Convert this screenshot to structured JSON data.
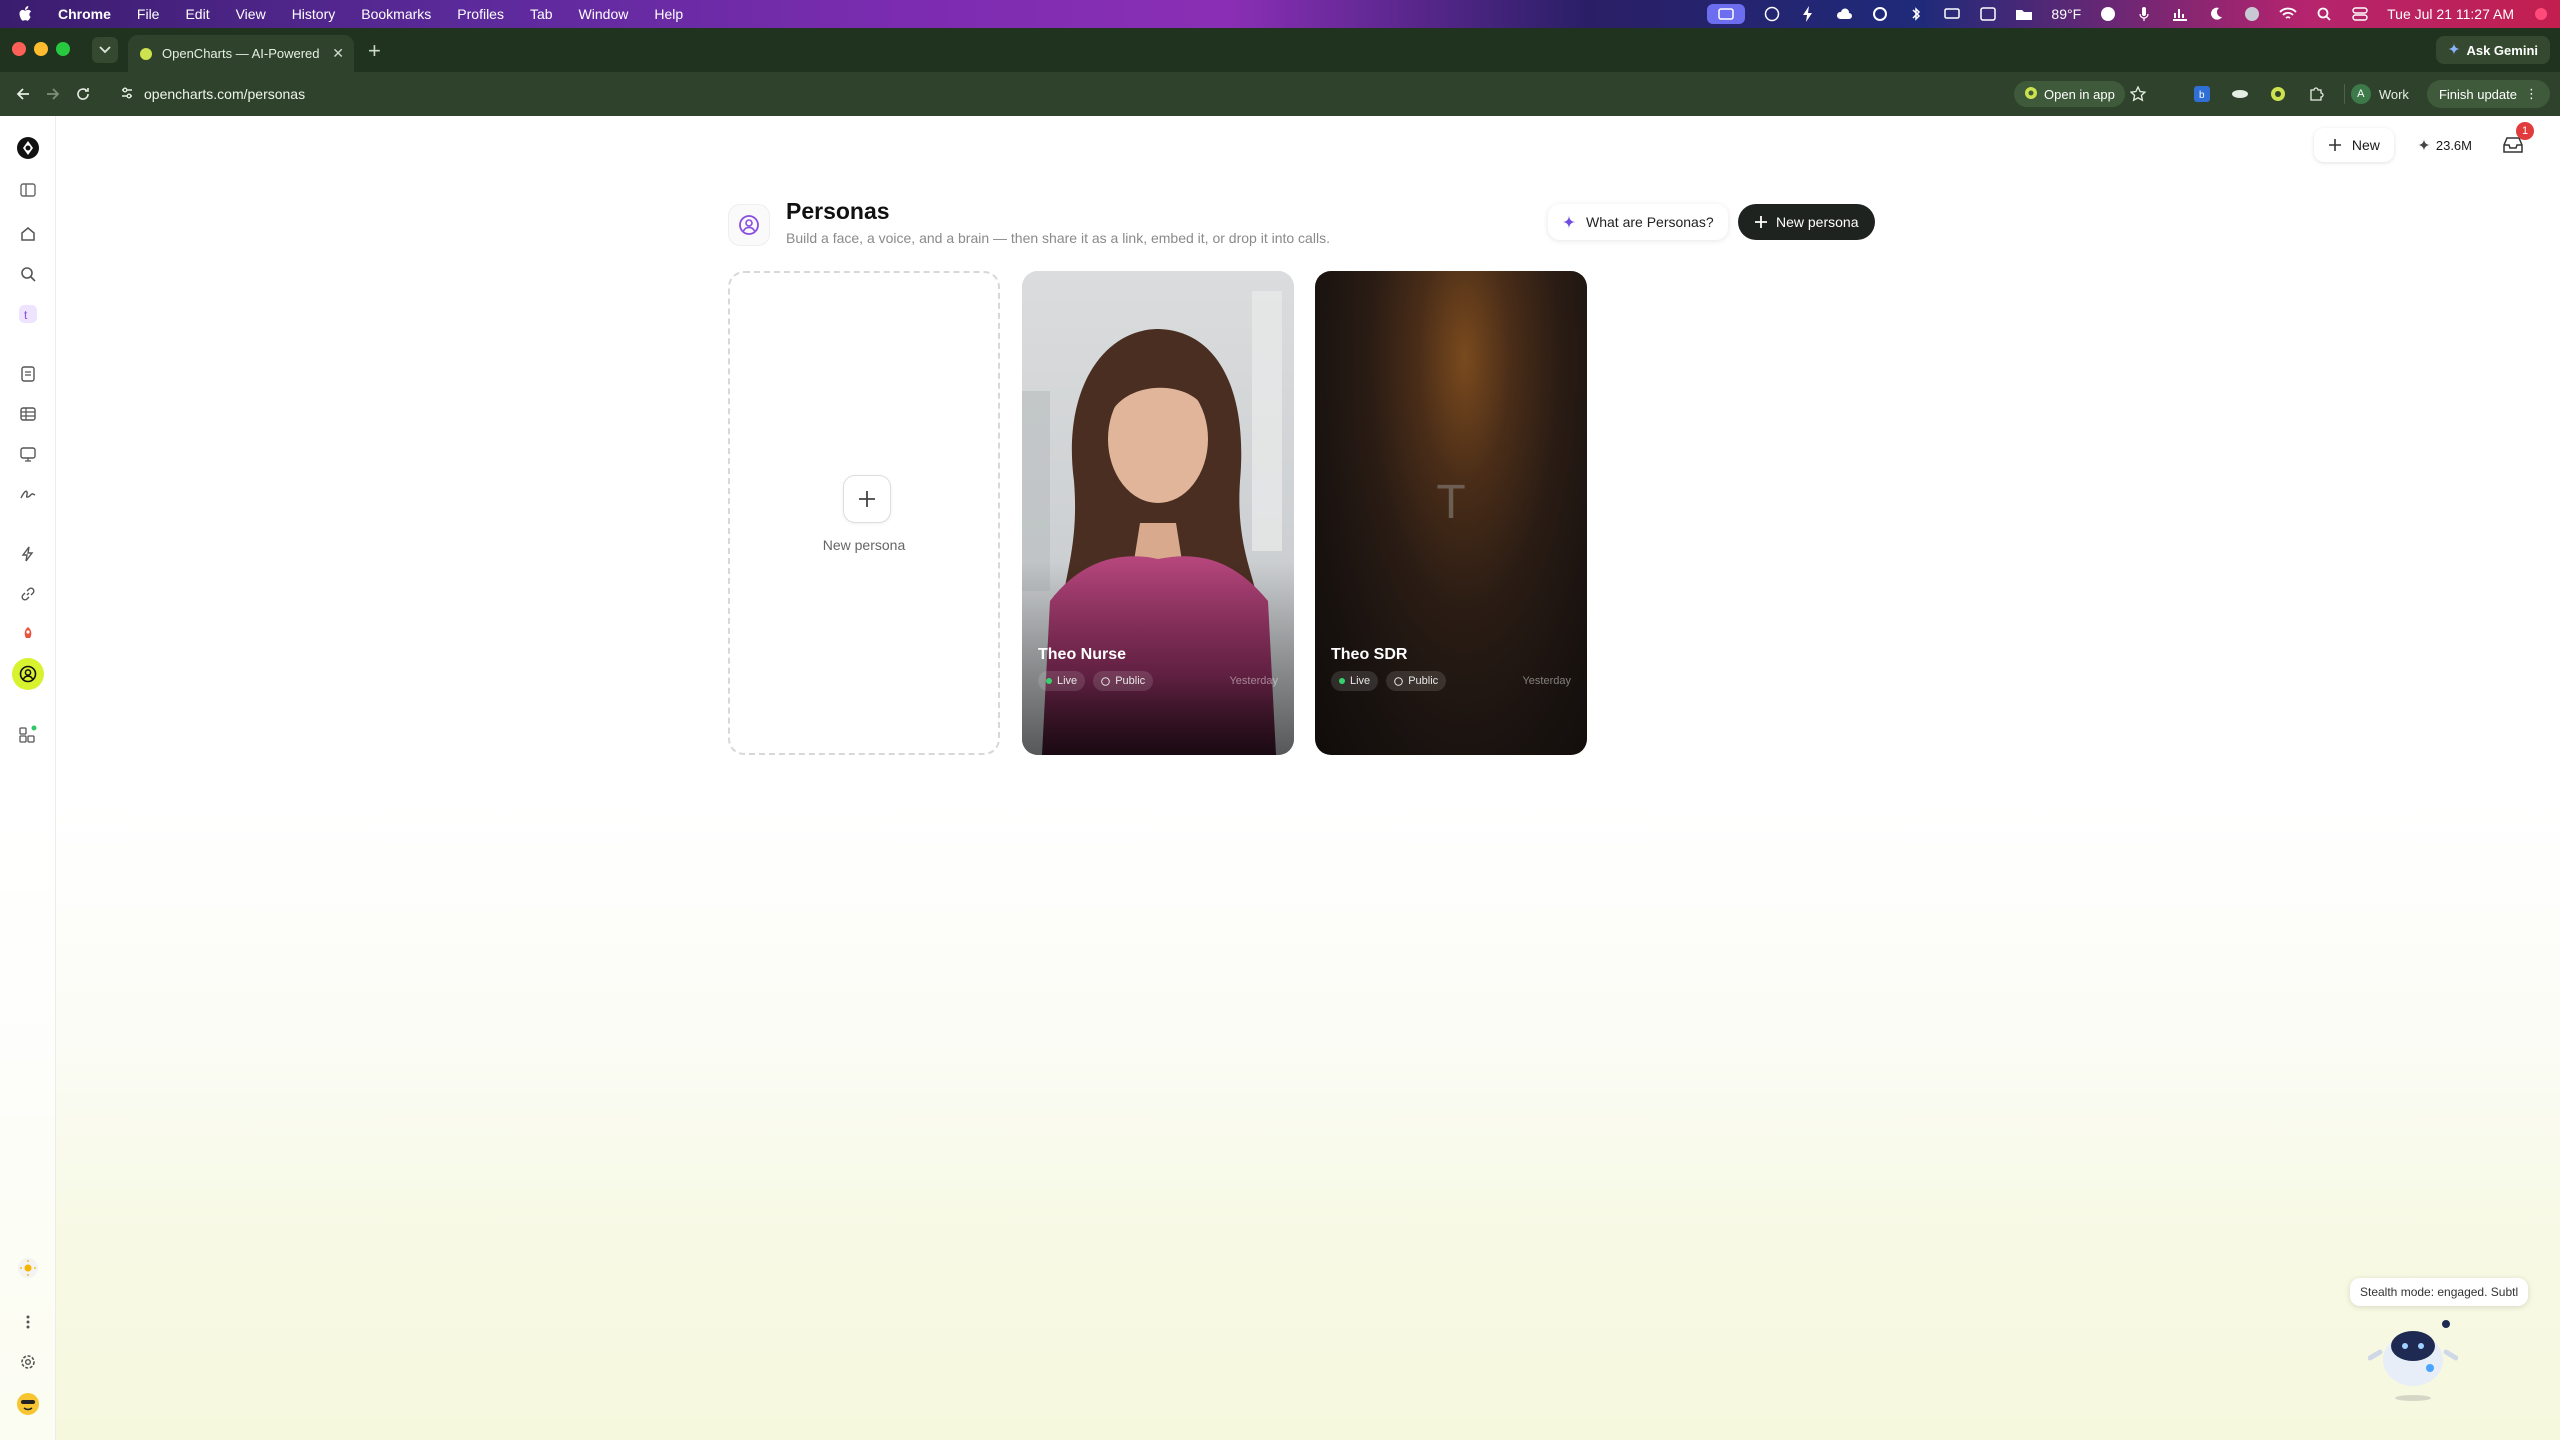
{
  "menubar": {
    "app": "Chrome",
    "items": [
      "File",
      "Edit",
      "View",
      "History",
      "Bookmarks",
      "Profiles",
      "Tab",
      "Window",
      "Help"
    ],
    "weather": "89°F",
    "datetime": "Tue Jul 21  11:27 AM"
  },
  "browser": {
    "tab_title": "OpenCharts — AI-Powered Fl",
    "ask_gemini": "Ask Gemini",
    "url": "opencharts.com/personas",
    "open_in_app": "Open in app",
    "profile_initial": "A",
    "profile_name": "Work",
    "finish_update": "Finish update"
  },
  "top_actions": {
    "new_label": "New",
    "credits": "23.6M",
    "inbox_badge": "1"
  },
  "header": {
    "title": "Personas",
    "subtitle": "Build a face, a voice, and a brain — then share it as a link, embed it, or drop it into calls.",
    "what_label": "What are Personas?",
    "new_persona_label": "New persona"
  },
  "new_card": {
    "label": "New persona"
  },
  "personas": [
    {
      "name": "Theo Nurse",
      "status": "Live",
      "visibility": "Public",
      "date": "Yesterday"
    },
    {
      "name": "Theo SDR",
      "status": "Live",
      "visibility": "Public",
      "date": "Yesterday",
      "initial": "T"
    }
  ],
  "mascot": {
    "bubble": "Stealth mode: engaged. Subtl"
  },
  "colors": {
    "accent": "#d9f22f",
    "dark_button": "#1f2320",
    "live_dot": "#35d46a"
  }
}
